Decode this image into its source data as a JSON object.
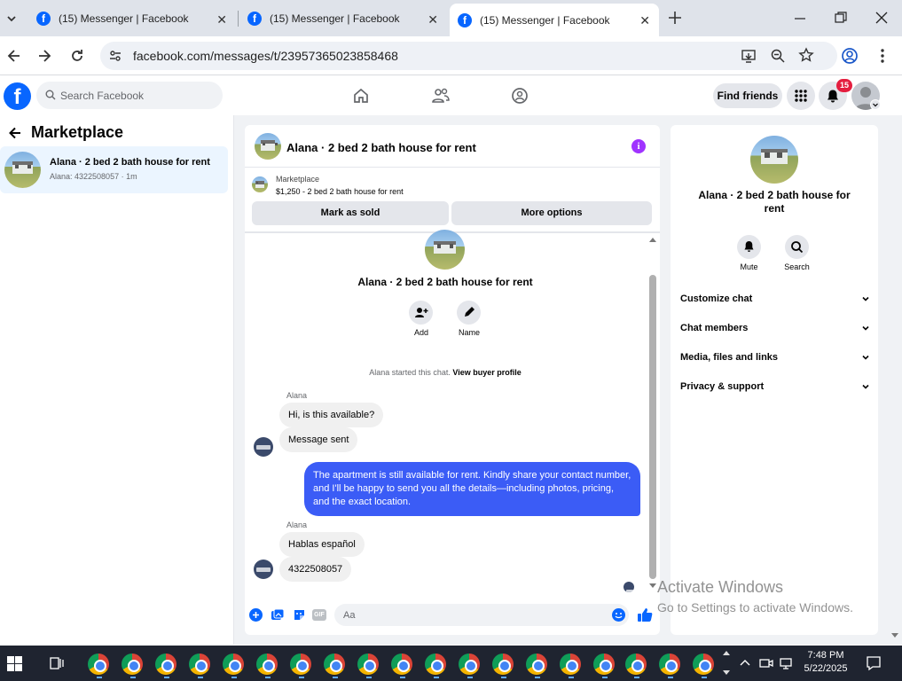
{
  "browser": {
    "tabs": [
      {
        "title": "(15) Messenger | Facebook"
      },
      {
        "title": "(15) Messenger | Facebook"
      },
      {
        "title": "(15) Messenger | Facebook"
      }
    ],
    "url": "facebook.com/messages/t/23957365023858468"
  },
  "fb_header": {
    "search_placeholder": "Search Facebook",
    "find_friends": "Find friends",
    "notification_count": "15"
  },
  "sidebar": {
    "title": "Marketplace",
    "conversations": [
      {
        "title": "Alana · 2 bed 2 bath house for rent",
        "preview": "Alana: 4322508057 · 1m"
      }
    ]
  },
  "chat": {
    "title": "Alana · 2 bed 2 bath house for rent",
    "listing": {
      "label": "Marketplace",
      "detail": "$1,250 - 2 bed 2 bath house for rent"
    },
    "mark_sold": "Mark as sold",
    "more_options": "More options",
    "intro_title": "Alana · 2 bed 2 bath house for rent",
    "add_label": "Add",
    "name_label": "Name",
    "system_message": "Alana started this chat.",
    "view_profile": "View buyer profile",
    "messages": [
      {
        "sender": "Alana",
        "text": "Hi, is this available?"
      },
      {
        "text": "Message sent"
      },
      {
        "text": "The apartment is still available for rent. Kindly share your contact number, and I'll be happy to send you all the details—including photos, pricing, and the exact location."
      },
      {
        "sender": "Alana",
        "text": "Hablas español"
      },
      {
        "text": "4322508057"
      }
    ],
    "composer_placeholder": "Aa"
  },
  "details": {
    "title": "Alana · 2 bed 2 bath house for rent",
    "mute": "Mute",
    "search": "Search",
    "sections": [
      "Customize chat",
      "Chat members",
      "Media, files and links",
      "Privacy & support"
    ]
  },
  "watermark": {
    "line1": "Activate Windows",
    "line2": "Go to Settings to activate Windows."
  },
  "taskbar": {
    "time": "7:48 PM",
    "date": "5/22/2025"
  },
  "colors": {
    "fb_blue": "#0866ff",
    "messenger_bubble": "#3b5cf6",
    "info_purple": "#a033ff",
    "notification_red": "#e41e3f"
  }
}
